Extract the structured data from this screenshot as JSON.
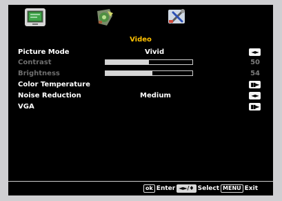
{
  "menu": {
    "title": "Video",
    "tabs": [
      {
        "name": "picture-tab",
        "icon": "tv-screen-icon",
        "selected": true
      },
      {
        "name": "audio-tab",
        "icon": "speaker-icon",
        "selected": false
      },
      {
        "name": "setup-tab",
        "icon": "wrench-screwdriver-icon",
        "selected": false
      }
    ],
    "items": [
      {
        "label": "Picture Mode",
        "value": "Vivid",
        "type": "select"
      },
      {
        "label": "Contrast",
        "value": "50",
        "level": 0.5,
        "type": "slider",
        "disabled": true
      },
      {
        "label": "Brightness",
        "value": "54",
        "level": 0.54,
        "type": "slider",
        "disabled": true
      },
      {
        "label": "Color Temperature",
        "type": "submenu"
      },
      {
        "label": "Noise Reduction",
        "value": "Medium",
        "type": "select"
      },
      {
        "label": "VGA",
        "type": "submenu"
      }
    ]
  },
  "footer": {
    "ok_key": "ok",
    "enter_label": "Enter",
    "nav_key": "◄►/♦",
    "select_label": "Select",
    "menu_key": "MENU",
    "exit_label": "Exit"
  },
  "colors": {
    "title": "#ffc000",
    "background": "#000000",
    "text": "#ffffff",
    "disabled_text": "#6e6e6e"
  }
}
